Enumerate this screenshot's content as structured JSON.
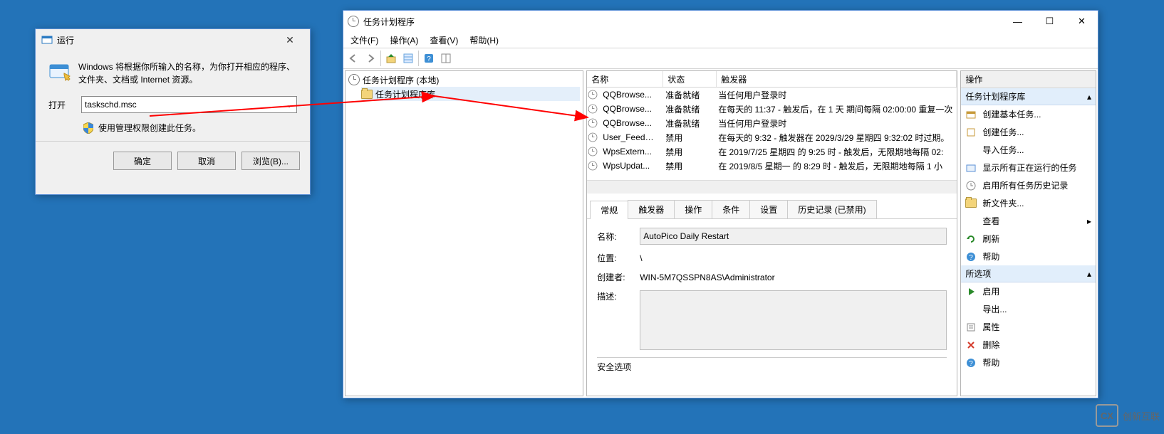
{
  "run_dialog": {
    "title": "运行",
    "description": "Windows 将根据你所输入的名称，为你打开相应的程序、文件夹、文档或 Internet 资源。",
    "open_label": "打开",
    "open_value": "taskschd.msc",
    "shield_note": "使用管理权限创建此任务。",
    "buttons": {
      "ok": "确定",
      "cancel": "取消",
      "browse": "浏览(B)..."
    }
  },
  "scheduler": {
    "title": "任务计划程序",
    "menu": {
      "file": "文件(F)",
      "action": "操作(A)",
      "view": "查看(V)",
      "help": "帮助(H)"
    },
    "tree": {
      "root": "任务计划程序 (本地)",
      "lib": "任务计划程序库"
    },
    "columns": {
      "name": "名称",
      "status": "状态",
      "trigger": "触发器"
    },
    "col_widths": {
      "name": 94,
      "status": 62,
      "trigger": 340
    },
    "tasks": [
      {
        "name": "QQBrowse...",
        "status": "准备就绪",
        "trigger": "当任何用户登录时"
      },
      {
        "name": "QQBrowse...",
        "status": "准备就绪",
        "trigger": "在每天的 11:37 - 触发后，在 1 天 期间每隔 02:00:00 重复一次"
      },
      {
        "name": "QQBrowse...",
        "status": "准备就绪",
        "trigger": "当任何用户登录时"
      },
      {
        "name": "User_Feed_...",
        "status": "禁用",
        "trigger": "在每天的 9:32 - 触发器在 2029/3/29 星期四 9:32:02 时过期。"
      },
      {
        "name": "WpsExtern...",
        "status": "禁用",
        "trigger": "在 2019/7/25 星期四 的 9:25 时 - 触发后，无限期地每隔 02:"
      },
      {
        "name": "WpsUpdat...",
        "status": "禁用",
        "trigger": "在 2019/8/5 星期一 的 8:29 时 - 触发后，无限期地每隔 1 小"
      }
    ],
    "tabs": {
      "general": "常规",
      "triggers": "触发器",
      "actions": "操作",
      "conditions": "条件",
      "settings": "设置",
      "history": "历史记录 (已禁用)"
    },
    "detail": {
      "name_label": "名称:",
      "name_value": "AutoPico Daily Restart",
      "location_label": "位置:",
      "location_value": "\\",
      "creator_label": "创建者:",
      "creator_value": "WIN-5M7QSSPN8AS\\Administrator",
      "desc_label": "描述:",
      "desc_value": "",
      "security_section": "安全选项"
    },
    "actions": {
      "pane_title": "操作",
      "section1": "任务计划程序库",
      "items1": [
        "创建基本任务...",
        "创建任务...",
        "导入任务...",
        "显示所有正在运行的任务",
        "启用所有任务历史记录",
        "新文件夹...",
        "查看",
        "刷新",
        "帮助"
      ],
      "section2": "所选项",
      "items2": [
        "启用",
        "导出...",
        "属性",
        "删除",
        "帮助"
      ]
    }
  },
  "watermark": "创新互联"
}
